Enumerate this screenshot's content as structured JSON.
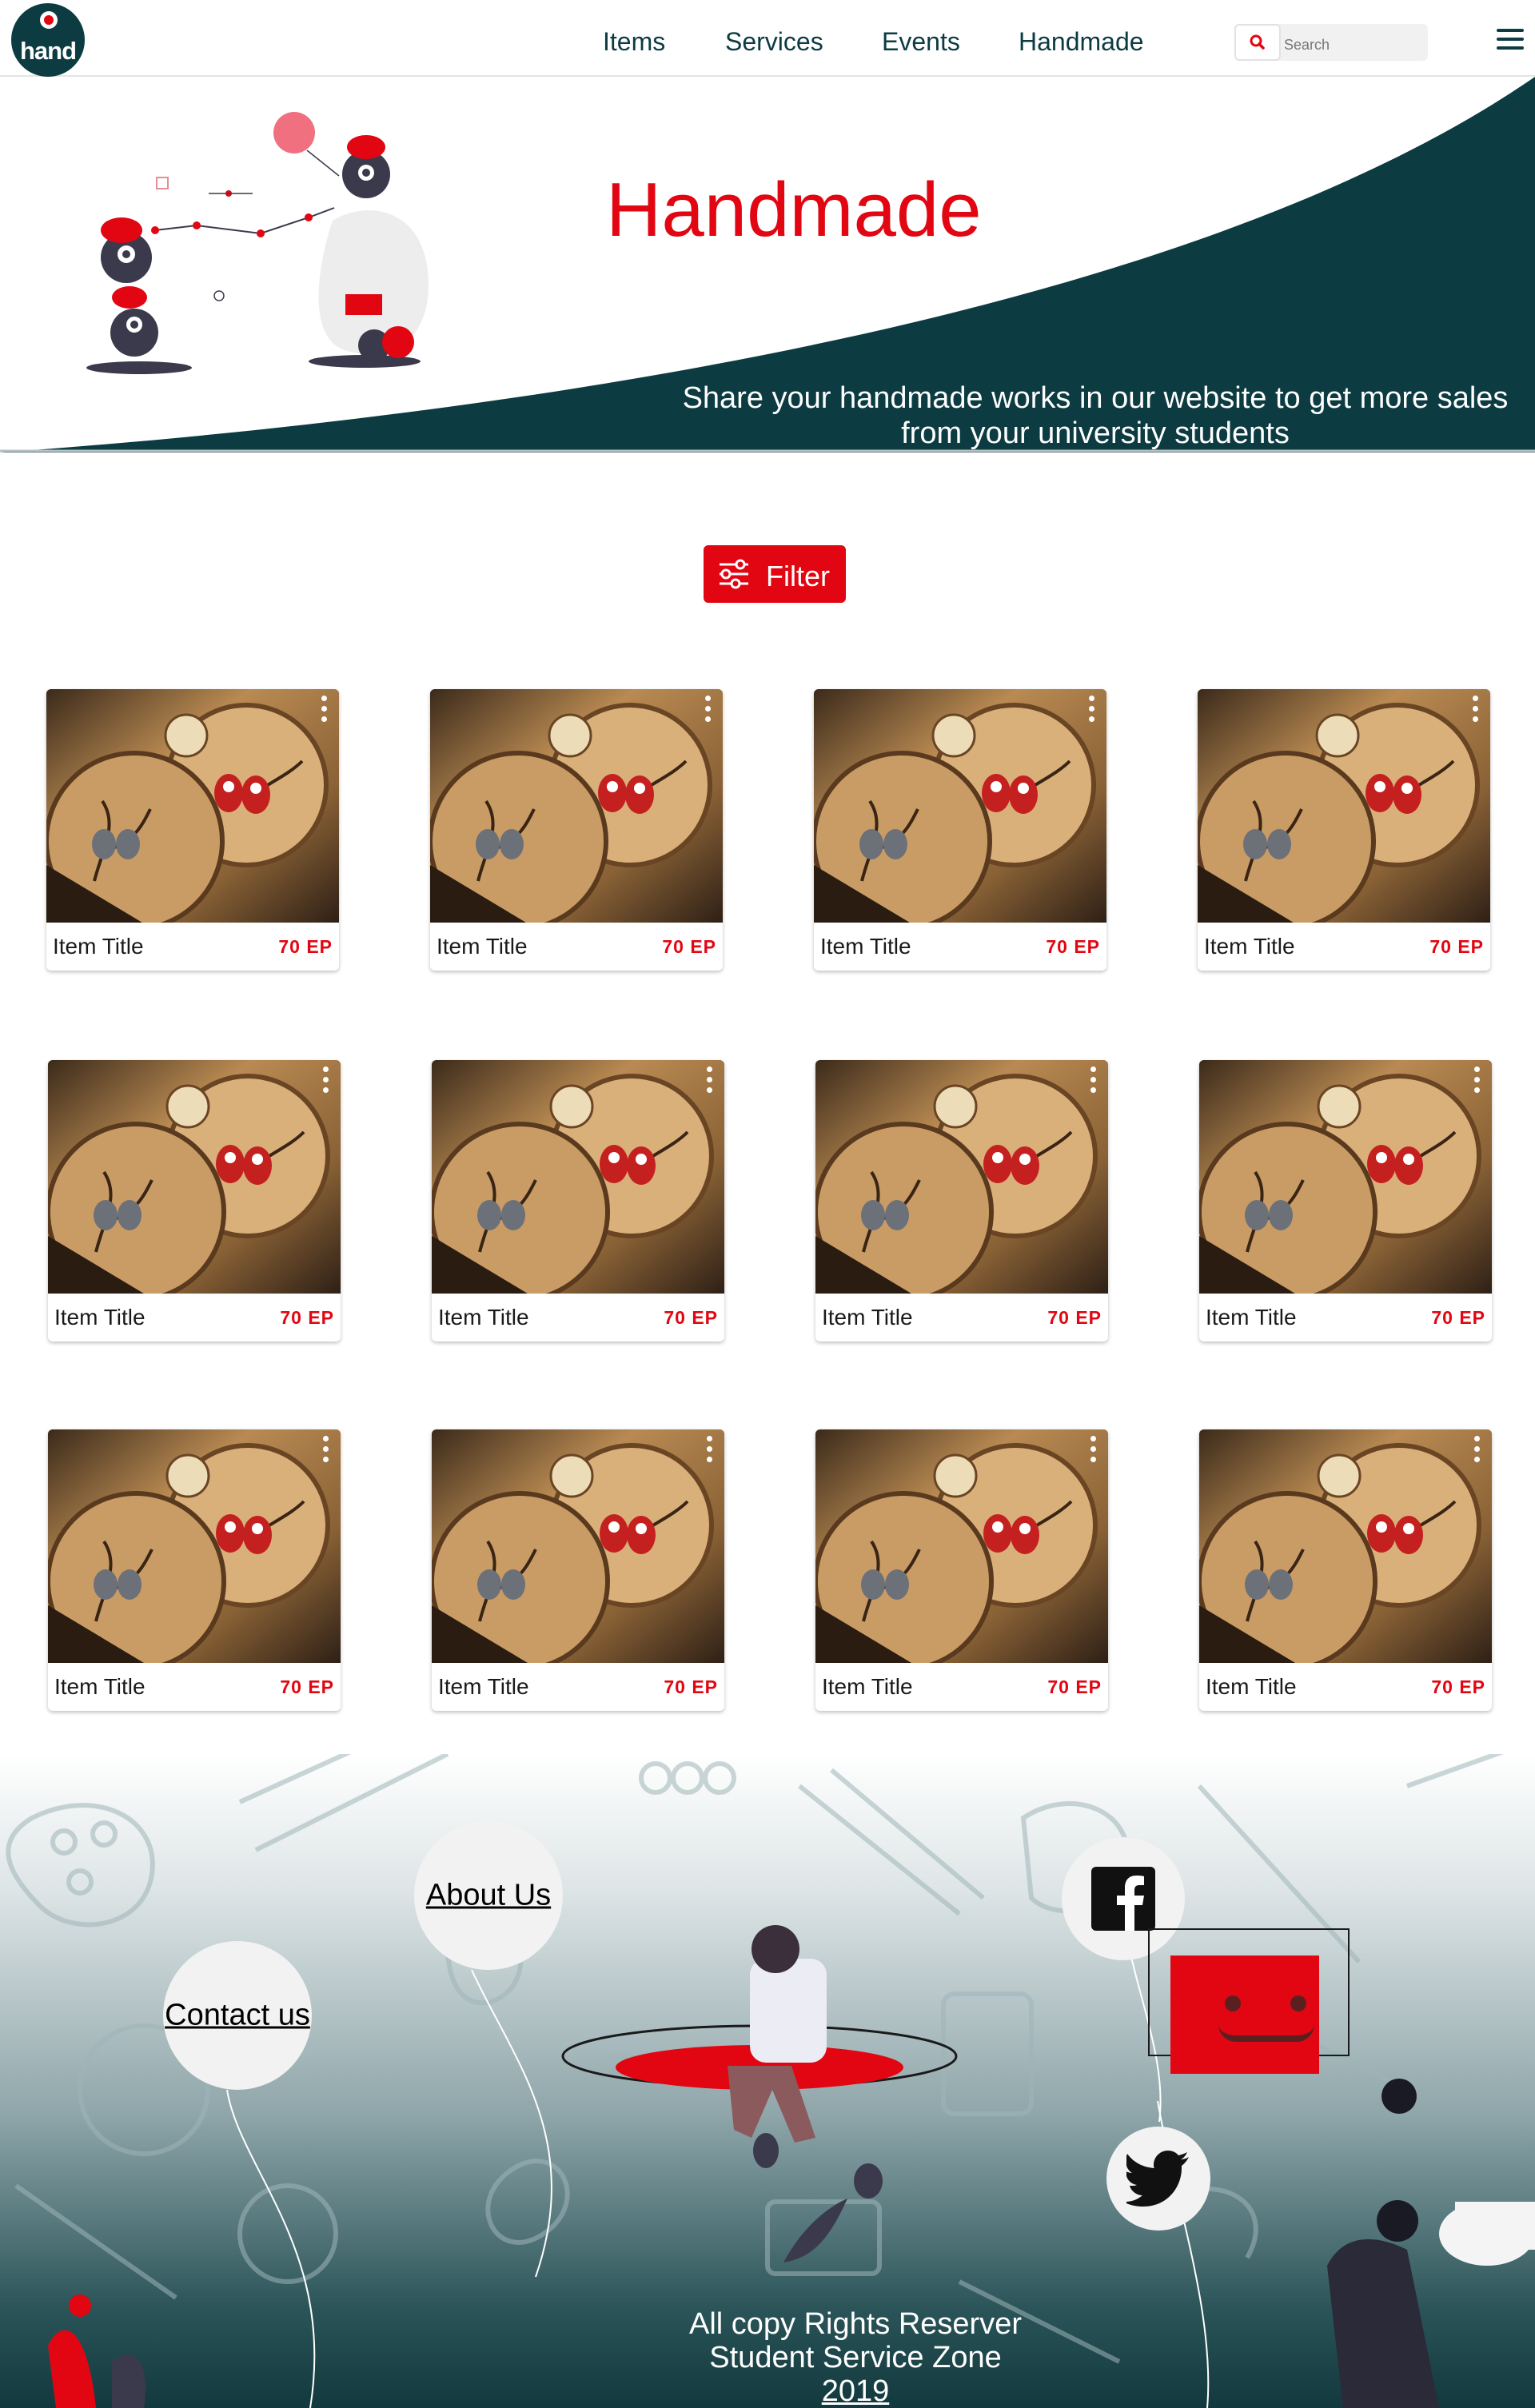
{
  "nav": {
    "logo_text": "hand",
    "links": [
      "Items",
      "Services",
      "Events",
      "Handmade"
    ],
    "search_placeholder": "Search"
  },
  "hero": {
    "title": "Handmade",
    "subtitle": "Share your handmade works in our website to get more sales from your university students"
  },
  "filter": {
    "label": "Filter"
  },
  "items": [
    {
      "title": "Item Title",
      "price": "70 EP"
    },
    {
      "title": "Item Title",
      "price": "70 EP"
    },
    {
      "title": "Item Title",
      "price": "70 EP"
    },
    {
      "title": "Item Title",
      "price": "70 EP"
    },
    {
      "title": "Item Title",
      "price": "70 EP"
    },
    {
      "title": "Item Title",
      "price": "70 EP"
    },
    {
      "title": "Item Title",
      "price": "70 EP"
    },
    {
      "title": "Item Title",
      "price": "70 EP"
    },
    {
      "title": "Item Title",
      "price": "70 EP"
    },
    {
      "title": "Item Title",
      "price": "70 EP"
    },
    {
      "title": "Item Title",
      "price": "70 EP"
    },
    {
      "title": "Item Title",
      "price": "70 EP"
    }
  ],
  "footer": {
    "about_label": "About Us",
    "contact_label": "Contact us",
    "copyright_line1": "All copy Rights Reserver",
    "copyright_line2": "Student Service Zone",
    "copyright_year": "2019"
  },
  "colors": {
    "brand_red": "#e20612",
    "brand_dark": "#0c3b42"
  },
  "icons": [
    "search-icon",
    "menu-icon",
    "filter-icon",
    "more-vertical-icon",
    "facebook-icon",
    "youtube-icon",
    "twitter-icon"
  ]
}
